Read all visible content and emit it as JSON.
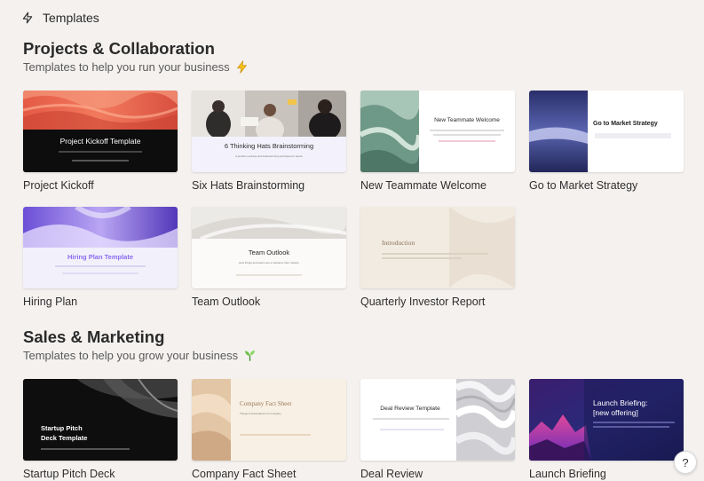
{
  "header": {
    "title": "Templates"
  },
  "sections": [
    {
      "title": "Projects & Collaboration",
      "subtitle": "Templates to help you run your business",
      "cards": [
        {
          "label": "Project Kickoff",
          "thumb_title": "Project Kickoff Template"
        },
        {
          "label": "Six Hats Brainstorming",
          "thumb_title": "6 Thinking Hats Brainstorming",
          "thumb_sub": "A problem-solving and brainstorming technique for teams"
        },
        {
          "label": "New Teammate Welcome",
          "thumb_title": "New Teammate Welcome"
        },
        {
          "label": "Go to Market Strategy",
          "thumb_title": "Go to Market Strategy"
        },
        {
          "label": "Hiring Plan",
          "thumb_title": "Hiring Plan Template"
        },
        {
          "label": "Team Outlook",
          "thumb_title": "Team Outlook",
          "thumb_sub": "How things and teams are to advance their mission"
        },
        {
          "label": "Quarterly Investor Report",
          "thumb_title": "Introduction"
        }
      ]
    },
    {
      "title": "Sales & Marketing",
      "subtitle": "Templates to help you grow your business",
      "cards": [
        {
          "label": "Startup Pitch Deck",
          "thumb_title_1": "Startup Pitch",
          "thumb_title_2": "Deck Template"
        },
        {
          "label": "Company Fact Sheet",
          "thumb_title": "Company Fact Sheet",
          "thumb_sub": "Things to know about our company"
        },
        {
          "label": "Deal Review",
          "thumb_title": "Deal Review Template"
        },
        {
          "label": "Launch Briefing",
          "thumb_title_1": "Launch Briefing:",
          "thumb_title_2": "[new offering]"
        }
      ]
    }
  ],
  "help": {
    "label": "?"
  },
  "colors": {
    "background": "#f4f1ef",
    "accent_purple": "#8a6cf0"
  }
}
